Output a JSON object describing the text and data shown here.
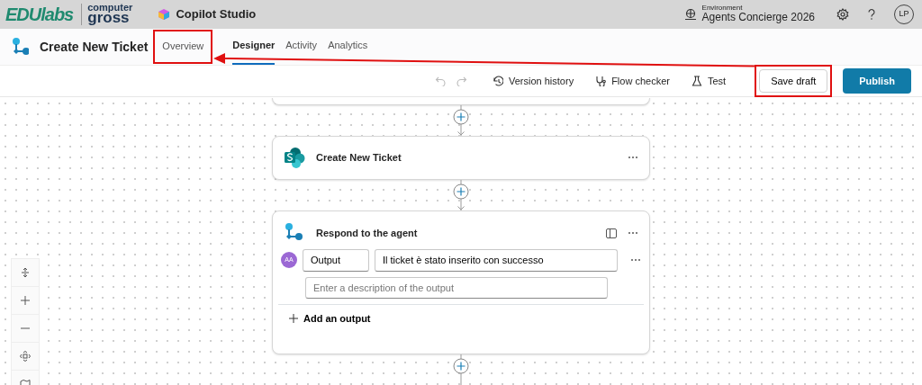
{
  "top_bar": {
    "logo_primary": "EDUlabs",
    "logo_secondary_top": "computer",
    "logo_secondary_bottom": "gross",
    "app_name": "Copilot Studio",
    "environment_label": "Environment",
    "environment_name": "Agents Concierge 2026",
    "avatar": "LP"
  },
  "header": {
    "title": "Create New Ticket",
    "tabs": [
      {
        "label": "Overview",
        "selected": false,
        "highlighted": true
      },
      {
        "label": "Designer",
        "selected": true,
        "highlighted": false
      },
      {
        "label": "Activity",
        "selected": false,
        "highlighted": false
      },
      {
        "label": "Analytics",
        "selected": false,
        "highlighted": false
      }
    ]
  },
  "toolbar": {
    "tools": [
      {
        "kind": "history",
        "label": "Version history"
      },
      {
        "kind": "checker",
        "label": "Flow checker"
      },
      {
        "kind": "test",
        "label": "Test"
      }
    ],
    "save_draft": {
      "label": "Save draft",
      "highlighted": true
    },
    "publish": {
      "label": "Publish"
    }
  },
  "annotation_arrow": true,
  "flow": {
    "nodes": [
      {
        "kind": "partial"
      },
      {
        "kind": "sharepoint",
        "title": "Create New Ticket"
      },
      {
        "kind": "respond",
        "title": "Respond to the agent",
        "outputs": [
          {
            "avatar": "AA",
            "name": "Output",
            "value": "Il ticket è stato inserito con successo",
            "placeholder": "Enter a description of the output"
          }
        ],
        "add_label": "Add an output"
      }
    ]
  }
}
